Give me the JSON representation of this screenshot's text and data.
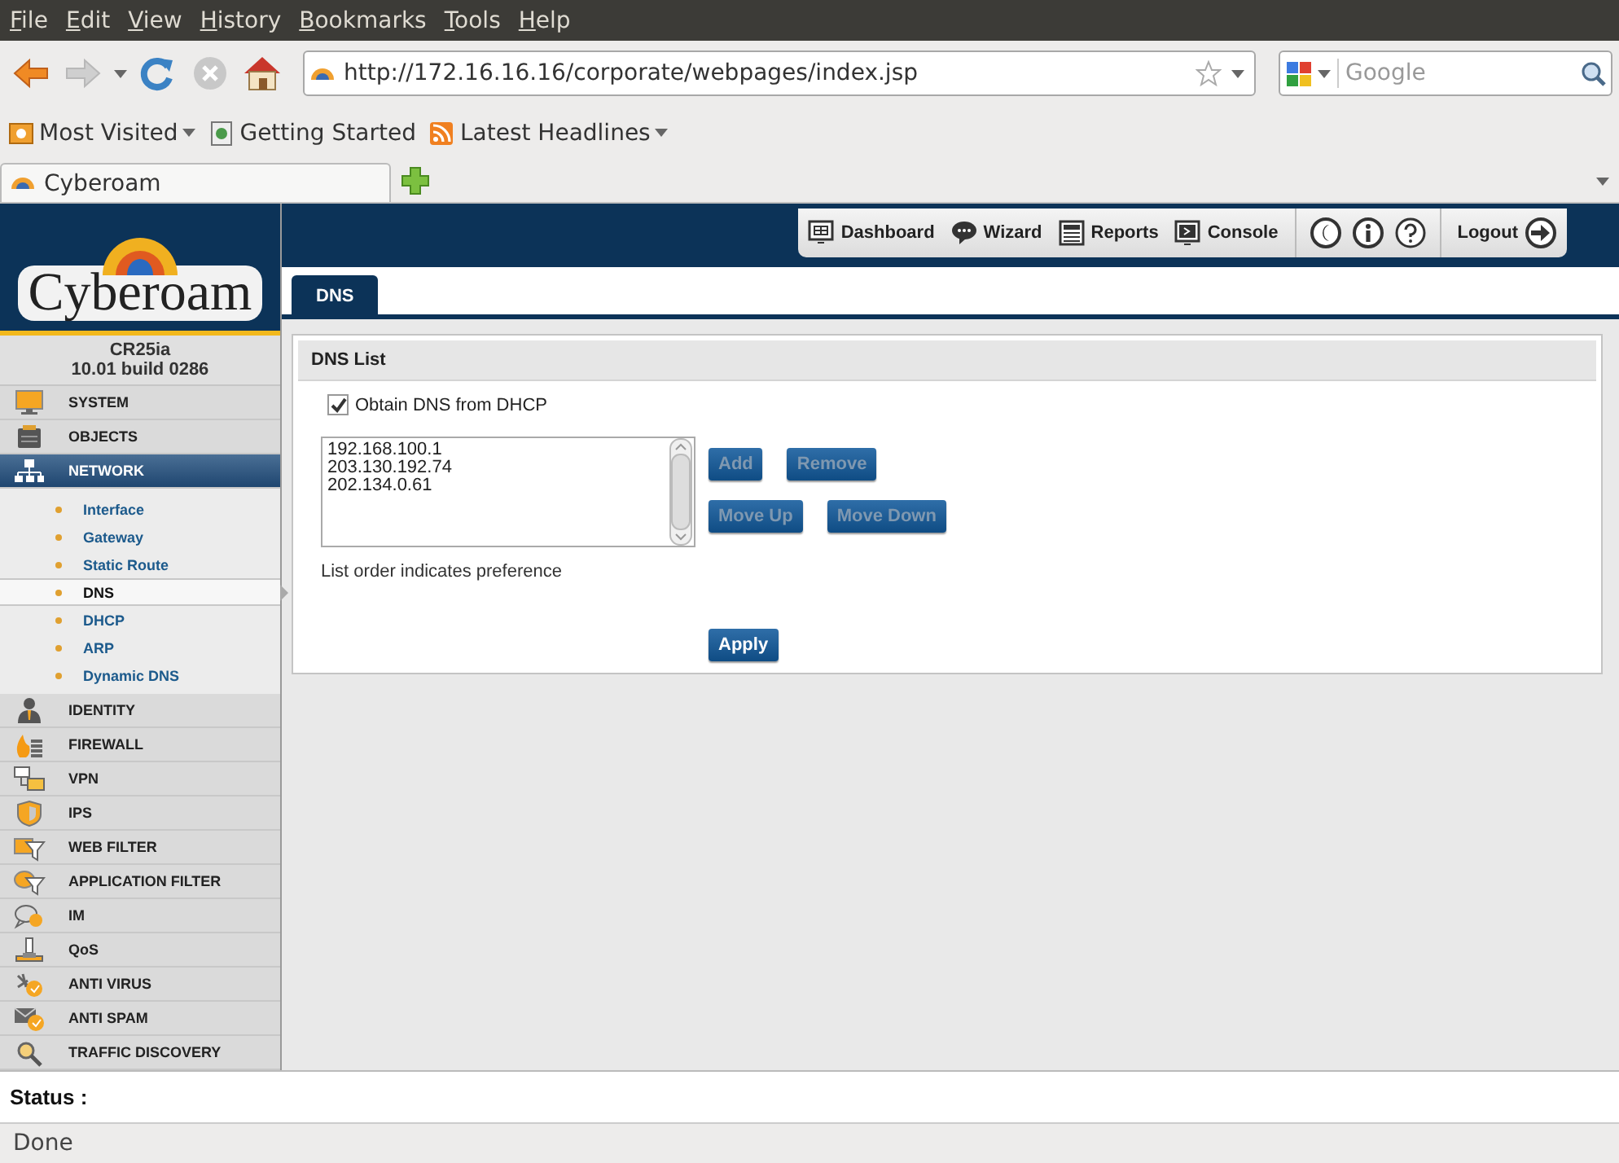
{
  "browser": {
    "menu": [
      "File",
      "Edit",
      "View",
      "History",
      "Bookmarks",
      "Tools",
      "Help"
    ],
    "address": "http://172.16.16.16/corporate/webpages/index.jsp",
    "search_placeholder": "Google",
    "bookmarks": [
      {
        "label": "Most Visited",
        "kind": "folder"
      },
      {
        "label": "Getting Started",
        "kind": "page"
      },
      {
        "label": "Latest Headlines",
        "kind": "feed"
      }
    ],
    "tabs": [
      {
        "label": "Cyberoam",
        "selected": true
      }
    ],
    "status": "Done"
  },
  "app": {
    "logo": "Cyberoam",
    "model": "CR25ia",
    "version": "10.01 build 0286",
    "toolbar": [
      "Dashboard",
      "Wizard",
      "Reports",
      "Console"
    ],
    "logout": "Logout",
    "sidebar": [
      {
        "label": "SYSTEM",
        "selected": false
      },
      {
        "label": "OBJECTS",
        "selected": false
      },
      {
        "label": "NETWORK",
        "selected": true,
        "children": [
          {
            "label": "Interface",
            "selected": false
          },
          {
            "label": "Gateway",
            "selected": false
          },
          {
            "label": "Static Route",
            "selected": false
          },
          {
            "label": "DNS",
            "selected": true
          },
          {
            "label": "DHCP",
            "selected": false
          },
          {
            "label": "ARP",
            "selected": false
          },
          {
            "label": "Dynamic DNS",
            "selected": false
          }
        ]
      },
      {
        "label": "IDENTITY",
        "selected": false
      },
      {
        "label": "FIREWALL",
        "selected": false
      },
      {
        "label": "VPN",
        "selected": false
      },
      {
        "label": "IPS",
        "selected": false
      },
      {
        "label": "WEB FILTER",
        "selected": false
      },
      {
        "label": "APPLICATION FILTER",
        "selected": false
      },
      {
        "label": "IM",
        "selected": false
      },
      {
        "label": "QoS",
        "selected": false
      },
      {
        "label": "ANTI VIRUS",
        "selected": false
      },
      {
        "label": "ANTI SPAM",
        "selected": false
      },
      {
        "label": "TRAFFIC DISCOVERY",
        "selected": false
      }
    ],
    "page_tabs": [
      {
        "label": "DNS",
        "selected": true
      }
    ],
    "section_title": "DNS List",
    "obtain_dhcp": {
      "label": "Obtain DNS from DHCP",
      "checked": true
    },
    "dns_servers": [
      "192.168.100.1",
      "203.130.192.74",
      "202.134.0.61"
    ],
    "button_rows": [
      [
        {
          "label": "Add",
          "disabled": true
        },
        {
          "label": "Remove",
          "disabled": true
        }
      ],
      [
        {
          "label": "Move Up",
          "disabled": true
        },
        {
          "label": "Move Down",
          "disabled": true
        }
      ]
    ],
    "hint": "List order indicates preference",
    "apply": {
      "label": "Apply",
      "disabled": false
    },
    "status_label": "Status :"
  }
}
